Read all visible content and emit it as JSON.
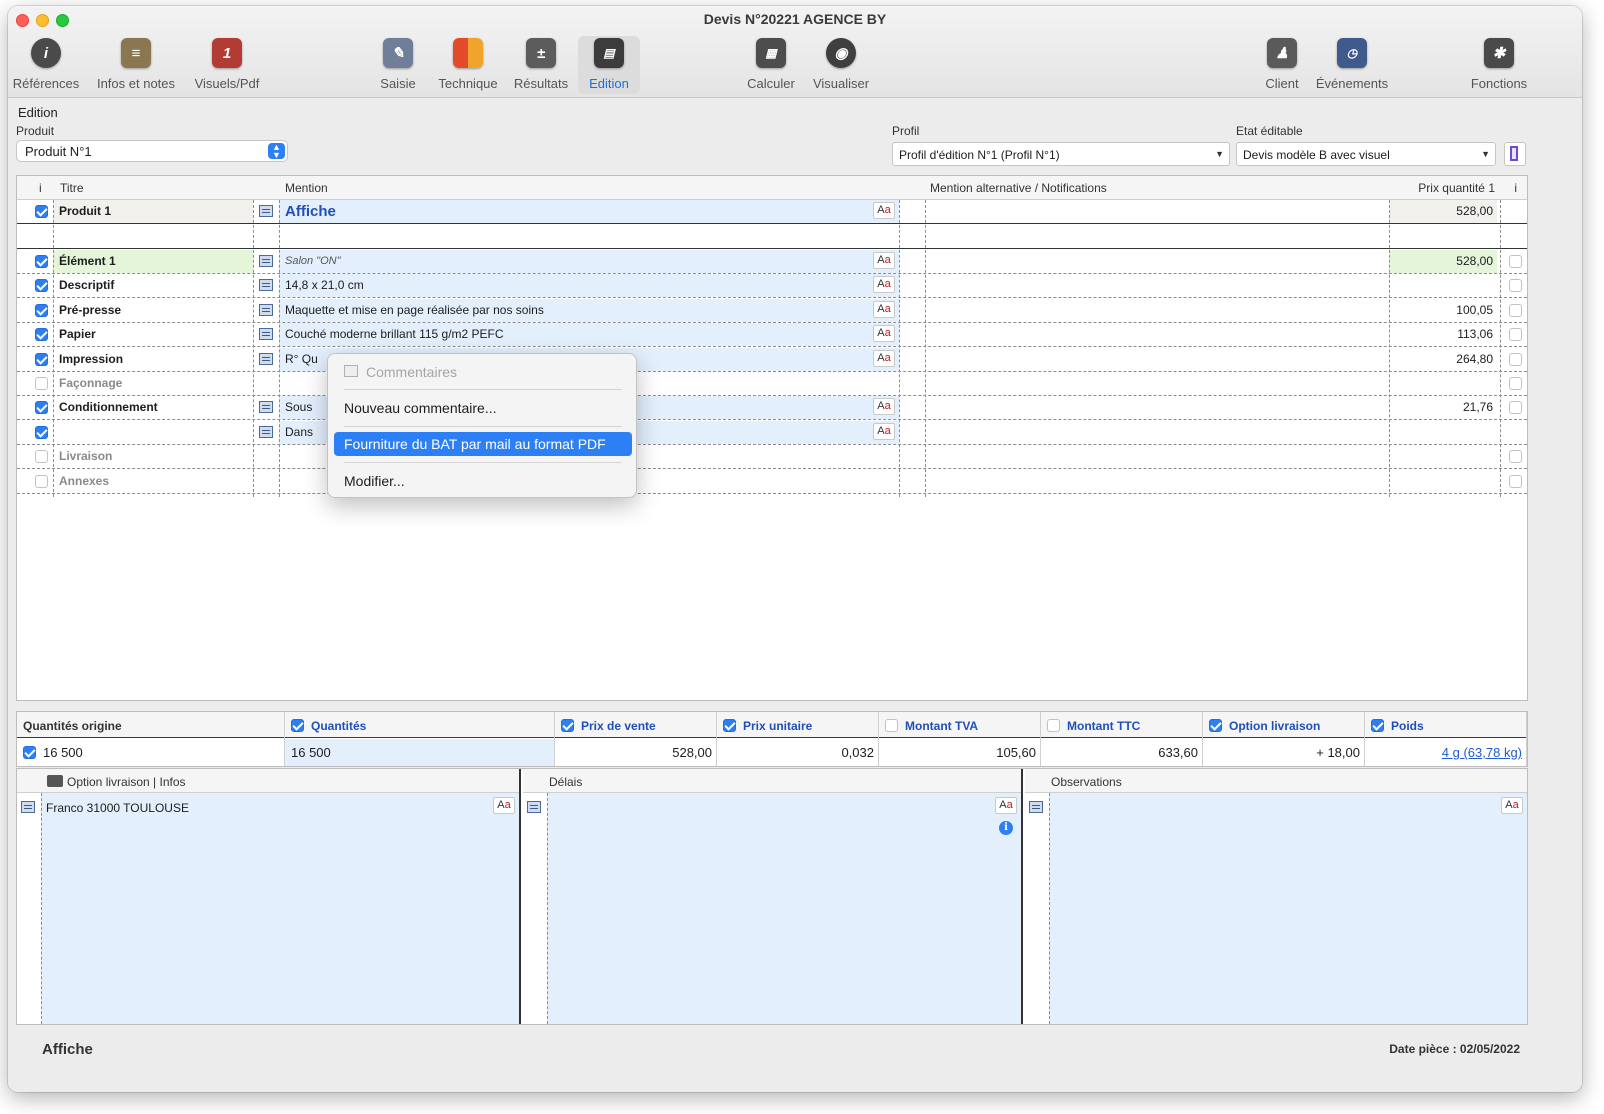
{
  "window": {
    "title": "Devis N°20221 AGENCE BY"
  },
  "toolbar": {
    "items": [
      {
        "label": "Références",
        "icon": "info-icon",
        "color": "#4a4a4a",
        "active": false
      },
      {
        "label": "Infos et notes",
        "icon": "notes-icon",
        "color": "#6b5a3a",
        "active": false
      },
      {
        "label": "Visuels/Pdf",
        "icon": "visual-pdf-icon",
        "color": "#b23b34",
        "active": false
      },
      {
        "label": "Saisie",
        "icon": "edit-form-icon",
        "color": "#4a6fa5",
        "active": false
      },
      {
        "label": "Technique",
        "icon": "technique-icon",
        "color": "#d9662b",
        "active": false
      },
      {
        "label": "Résultats",
        "icon": "calculator-results-icon",
        "color": "#5c5c5c",
        "active": false
      },
      {
        "label": "Edition",
        "icon": "edition-icon",
        "color": "#3c3c3c",
        "active": true
      },
      {
        "label": "Calculer",
        "icon": "calculate-icon",
        "color": "#4d4d4d",
        "active": false
      },
      {
        "label": "Visualiser",
        "icon": "eye-icon",
        "color": "#3f3f3f",
        "active": false
      },
      {
        "label": "Client",
        "icon": "client-icon",
        "color": "#555555",
        "active": false
      },
      {
        "label": "Événements",
        "icon": "events-icon",
        "color": "#3e5b8c",
        "active": false
      },
      {
        "label": "Fonctions",
        "icon": "gear-icon",
        "color": "#4a4a4a",
        "active": false
      }
    ]
  },
  "section": {
    "label": "Edition"
  },
  "fields": {
    "produit_label": "Produit",
    "produit_value": "Produit N°1",
    "profil_label": "Profil",
    "profil_value": "Profil d'édition N°1 (Profil N°1)",
    "etat_label": "Etat éditable",
    "etat_value": "Devis modèle B avec visuel"
  },
  "table": {
    "headers": {
      "i": "i",
      "titre": "Titre",
      "mention": "Mention",
      "alt": "Mention alternative / Notifications",
      "prix": "Prix quantité 1",
      "i2": "i"
    },
    "top_row": {
      "titre": "Produit 1",
      "mention": "Affiche",
      "prix": "528,00"
    },
    "rows": [
      {
        "checked": true,
        "titre": "Élément 1",
        "mention": "Salon \"ON\"",
        "prix": "528,00",
        "editable": true
      },
      {
        "checked": true,
        "titre": "Descriptif",
        "mention": "14,8 x 21,0 cm",
        "prix": "",
        "editable": true
      },
      {
        "checked": true,
        "titre": "Pré-presse",
        "mention": "Maquette et mise en page réalisée par nos soins",
        "prix": "100,05",
        "editable": true
      },
      {
        "checked": true,
        "titre": "Papier",
        "mention": "Couché moderne brillant 115 g/m2 PEFC",
        "prix": "113,06",
        "editable": true
      },
      {
        "checked": true,
        "titre": "Impression",
        "mention": "R° Qu",
        "prix": "264,80",
        "editable": true
      },
      {
        "checked": false,
        "titre": "Façonnage",
        "mention": "",
        "prix": "",
        "editable": false
      },
      {
        "checked": true,
        "titre": "Conditionnement",
        "mention": "Sous",
        "prix": "21,76",
        "editable": true
      },
      {
        "checked": true,
        "titre": "",
        "mention": "Dans",
        "prix": "",
        "editable": true
      },
      {
        "checked": false,
        "titre": "Livraison",
        "mention": "",
        "prix": "",
        "editable": false
      },
      {
        "checked": false,
        "titre": "Annexes",
        "mention": "",
        "prix": "",
        "editable": false
      }
    ]
  },
  "context_menu": {
    "header": "Commentaires",
    "new_comment": "Nouveau commentaire...",
    "selected": "Fourniture du BAT par mail au format PDF",
    "modify": "Modifier..."
  },
  "quantities": {
    "cols": [
      {
        "label": "Quantités origine",
        "checkbox": false,
        "value": "16 500",
        "value_checkbox": true
      },
      {
        "label": "Quantités",
        "checkbox": true,
        "checked": true,
        "value": "16 500"
      },
      {
        "label": "Prix de vente",
        "checkbox": true,
        "checked": true,
        "value": "528,00"
      },
      {
        "label": "Prix unitaire",
        "checkbox": true,
        "checked": true,
        "value": "0,032"
      },
      {
        "label": "Montant TVA",
        "checkbox": true,
        "checked": false,
        "value": "105,60"
      },
      {
        "label": "Montant TTC",
        "checkbox": true,
        "checked": false,
        "value": "633,60"
      },
      {
        "label": "Option livraison",
        "checkbox": true,
        "checked": true,
        "value": "+ 18,00"
      },
      {
        "label": "Poids",
        "checkbox": true,
        "checked": true,
        "value": "4 g (63,78 kg)"
      }
    ]
  },
  "panels": {
    "livraison_label": "Option livraison | Infos",
    "livraison_text": "Franco 31000 TOULOUSE",
    "delais_label": "Délais",
    "observations_label": "Observations"
  },
  "footer": {
    "product": "Affiche",
    "date": "Date pièce : 02/05/2022"
  },
  "aa_label": {
    "a": "A",
    "b": "a"
  }
}
